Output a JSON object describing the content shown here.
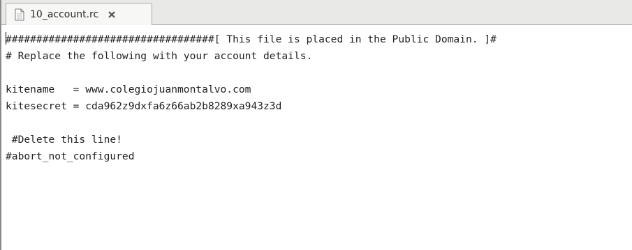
{
  "tab": {
    "label": "10_account.rc",
    "icon": "file-icon",
    "close_icon": "close-icon"
  },
  "editor": {
    "lines": [
      "##################################[ This file is placed in the Public Domain. ]#",
      "# Replace the following with your account details.",
      "",
      "kitename   = www.colegiojuanmontalvo.com",
      "kitesecret = cda962z9dxfa6z66ab2b8289xa943z3d",
      "",
      " #Delete this line!",
      "#abort_not_configured"
    ]
  }
}
